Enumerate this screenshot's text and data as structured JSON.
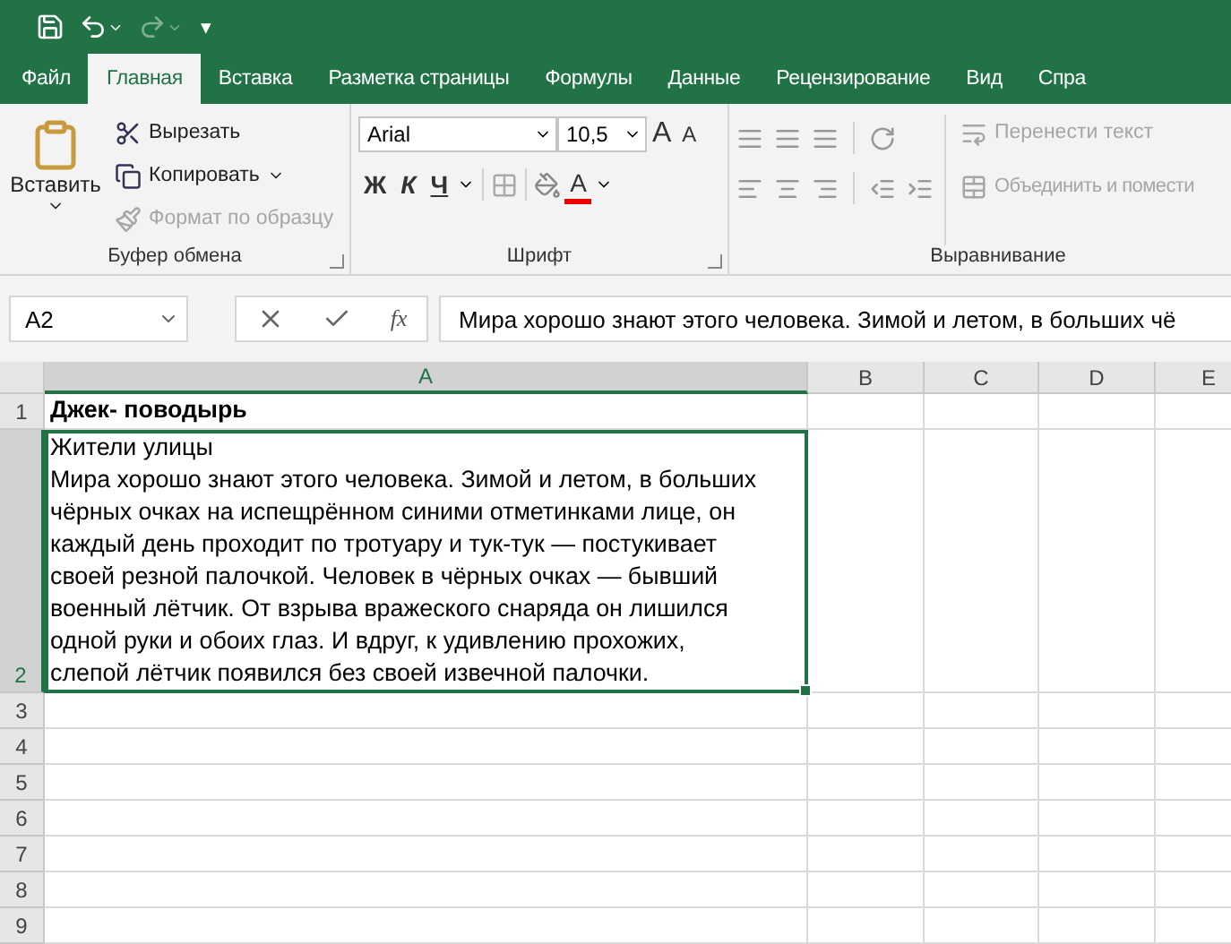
{
  "quick_access": {
    "customize": "▾"
  },
  "tabs": [
    {
      "label": "Файл",
      "selected": false
    },
    {
      "label": "Главная",
      "selected": true
    },
    {
      "label": "Вставка",
      "selected": false
    },
    {
      "label": "Разметка страницы",
      "selected": false
    },
    {
      "label": "Формулы",
      "selected": false
    },
    {
      "label": "Данные",
      "selected": false
    },
    {
      "label": "Рецензирование",
      "selected": false
    },
    {
      "label": "Вид",
      "selected": false
    },
    {
      "label": "Спра",
      "selected": false
    }
  ],
  "clipboard": {
    "paste": "Вставить",
    "cut": "Вырезать",
    "copy": "Копировать",
    "format_painter": "Формат по образцу",
    "group_label": "Буфер обмена",
    "format_painter_disabled": true
  },
  "font": {
    "name": "Arial",
    "size": "10,5",
    "grow": "A",
    "shrink": "A",
    "bold": "Ж",
    "italic": "К",
    "underline": "Ч",
    "font_color": "A",
    "group_label": "Шрифт"
  },
  "alignment": {
    "wrap_text": "Перенести текст",
    "merge": "Объединить и помести",
    "group_label": "Выравнивание"
  },
  "formula_bar": {
    "name_box": "A2",
    "fx": "fx",
    "value": "Мира хорошо знают этого человека. Зимой и летом, в больших чё"
  },
  "columns": [
    {
      "label": "A",
      "selected": true
    },
    {
      "label": "B",
      "selected": false
    },
    {
      "label": "C",
      "selected": false
    },
    {
      "label": "D",
      "selected": false
    },
    {
      "label": "E",
      "selected": false
    }
  ],
  "rows": [
    {
      "label": "1",
      "selected": false,
      "cell_a": [
        "Джек- поводырь"
      ],
      "bold": true
    },
    {
      "label": "2",
      "selected": true,
      "bold": false,
      "cell_a": [
        "Жители улицы",
        "Мира хорошо знают этого человека. Зимой и летом, в больших",
        "чёрных очках на испещрённом синими отметинками лице, он",
        "каждый день проходит по тротуару и тук-тук — постукивает",
        "своей резной палочкой. Человек в чёрных очках — бывший",
        "военный лётчик. От взрыва вражеского снаряда он лишился",
        "одной руки и обоих глаз. И вдруг, к удивлению прохожих,",
        "слепой лётчик появился без своей извечной палочки."
      ]
    },
    {
      "label": "3",
      "selected": false,
      "cell_a": []
    },
    {
      "label": "4",
      "selected": false,
      "cell_a": []
    },
    {
      "label": "5",
      "selected": false,
      "cell_a": []
    },
    {
      "label": "6",
      "selected": false,
      "cell_a": []
    },
    {
      "label": "7",
      "selected": false,
      "cell_a": []
    },
    {
      "label": "8",
      "selected": false,
      "cell_a": []
    },
    {
      "label": "9",
      "selected": false,
      "cell_a": []
    }
  ]
}
